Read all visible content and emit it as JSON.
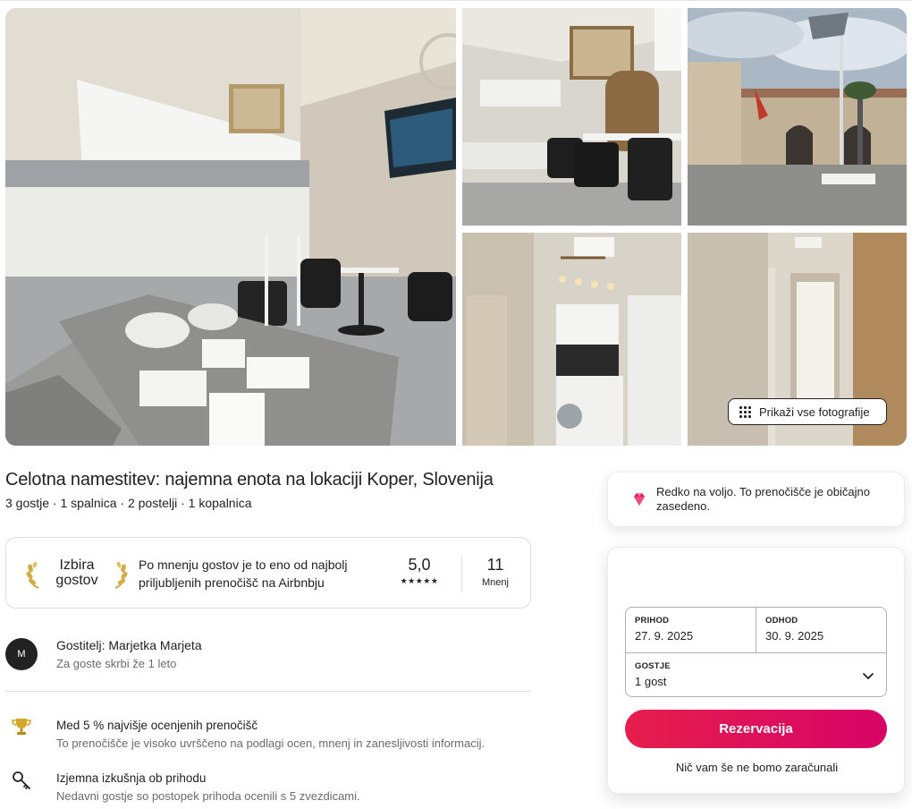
{
  "gallery": {
    "show_all_label": "Prikaži vse fotografije"
  },
  "listing": {
    "title": "Celotna namestitev: najemna enota na lokaciji Koper, Slovenija",
    "subtitle": "3 gostje · 1 spalnica · 2 postelji · 1 kopalnica"
  },
  "guest_favorite": {
    "badge_line1": "Izbira",
    "badge_line2": "gostov",
    "description": "Po mnenju gostov je to eno od najbolj priljubljenih prenočišč na Airbnbju",
    "rating": "5,0",
    "stars": "★★★★★",
    "reviews_count": "11",
    "reviews_label": "Mnenj"
  },
  "host": {
    "initial": "M",
    "name": "Gostitelj: Marjetka Marjeta",
    "since": "Za goste skrbi že 1 leto"
  },
  "highlights": [
    {
      "icon": "trophy-icon",
      "title": "Med 5 % najvišje ocenjenih prenočišč",
      "desc": "To prenočišče je visoko uvrščeno na podlagi ocen, mnenj in zanesljivosti informacij."
    },
    {
      "icon": "key-icon",
      "title": "Izjemna izkušnja ob prihodu",
      "desc": "Nedavni gostje so postopek prihoda ocenili s 5 zvezdicami."
    }
  ],
  "rare_notice": {
    "text": "Redko na voljo. To prenočišče je običajno zasedeno."
  },
  "booking": {
    "checkin_label": "PRIHOD",
    "checkin_value": "27. 9. 2025",
    "checkout_label": "ODHOD",
    "checkout_value": "30. 9. 2025",
    "guests_label": "GOSTJE",
    "guests_value": "1 gost",
    "reserve_label": "Rezervacija",
    "no_charge_note": "Nič vam še ne bomo zaračunali"
  },
  "colors": {
    "brand": "#e61e4d",
    "text": "#222222",
    "muted": "#6a6a6a",
    "border": "#dddddd"
  }
}
